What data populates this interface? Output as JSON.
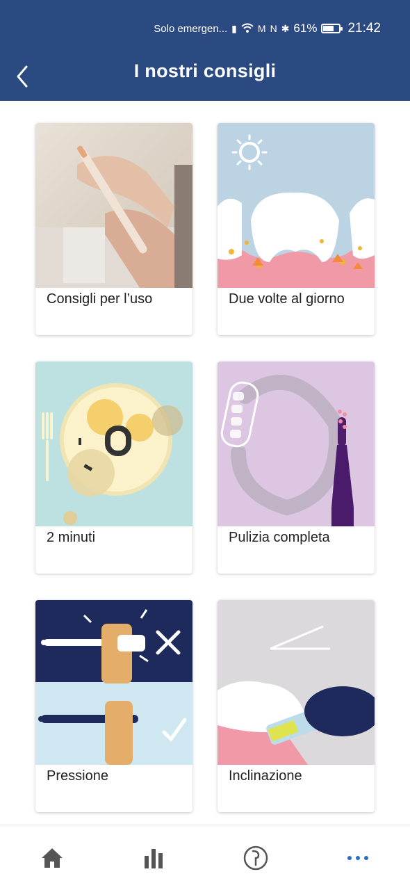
{
  "status": {
    "carrier": "Solo emergen...",
    "battery_percent": 61,
    "battery_text": "61%",
    "time": "21:42"
  },
  "header": {
    "title": "I nostri consigli",
    "background": "#2b4a82"
  },
  "cards": [
    {
      "label": "Consigli per l’uso",
      "icon": "toothbrush-hands-photo"
    },
    {
      "label": "Due volte al giorno",
      "icon": "teeth-sun-illustration"
    },
    {
      "label": "2 minuti",
      "icon": "plate-fork-illustration"
    },
    {
      "label": "Pulizia completa",
      "icon": "dental-arch-illustration"
    },
    {
      "label": "Pressione",
      "icon": "pressure-illustration"
    },
    {
      "label": "Inclinazione",
      "icon": "angle-illustration"
    }
  ],
  "nav": {
    "items": [
      "home-icon",
      "stats-icon",
      "brush-icon",
      "more-icon"
    ],
    "accent": "#2b6cc4",
    "icon_color": "#555555"
  }
}
